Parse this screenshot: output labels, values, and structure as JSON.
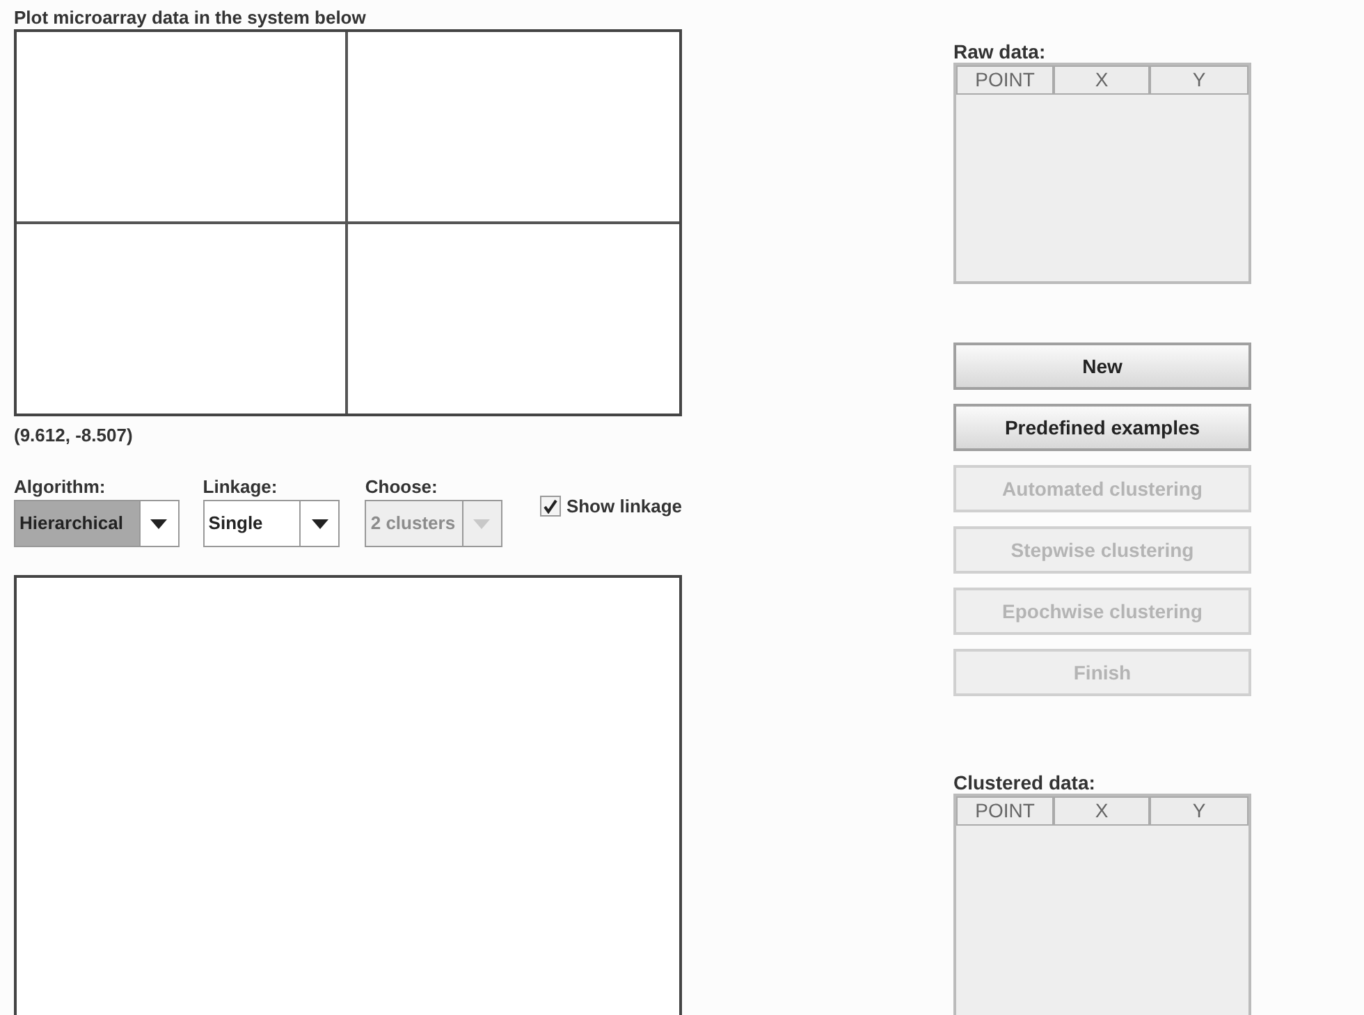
{
  "plot_panel": {
    "title": "Plot microarray data in the system below",
    "coordinates": "(9.612, -8.507)"
  },
  "selectors": [
    {
      "label": "Algorithm:",
      "value": "Hierarchical",
      "focused": true,
      "disabled": false
    },
    {
      "label": "Linkage:",
      "value": "Single",
      "focused": false,
      "disabled": false
    },
    {
      "label": "Choose:",
      "value": "2 clusters",
      "focused": false,
      "disabled": true
    }
  ],
  "show_linkage": {
    "label": "Show linkage",
    "checked": true
  },
  "raw_data": {
    "label": "Raw data:",
    "columns": [
      "POINT",
      "X",
      "Y"
    ]
  },
  "buttons": [
    {
      "label": "New",
      "disabled": false
    },
    {
      "label": "Predefined examples",
      "disabled": false
    },
    {
      "label": "Automated clustering",
      "disabled": true
    },
    {
      "label": "Stepwise clustering",
      "disabled": true
    },
    {
      "label": "Epochwise clustering",
      "disabled": true
    },
    {
      "label": "Finish",
      "disabled": true
    }
  ],
  "clustered_data": {
    "label": "Clustered data:",
    "columns": [
      "POINT",
      "X",
      "Y"
    ]
  }
}
